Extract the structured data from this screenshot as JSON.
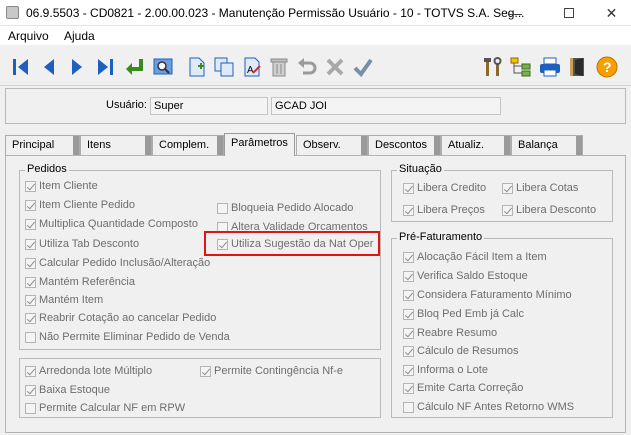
{
  "window": {
    "title": "06.9.5503 - CD0821 - 2.00.00.023 - Manutenção Permissão Usuário - 10 - TOTVS S.A. Seg...",
    "minimize": "—",
    "close": "✕"
  },
  "menu": [
    "Arquivo",
    "Ajuda"
  ],
  "toolbar": {
    "icons": [
      "first-icon",
      "prev-icon",
      "next-icon",
      "last-icon",
      "goto-icon",
      "search-icon",
      "new-icon",
      "copy-icon",
      "edit-icon",
      "delete-icon",
      "undo-icon",
      "cancel-icon",
      "confirm-icon",
      "tools-icon",
      "tree-icon",
      "print-icon",
      "exit-icon",
      "help-icon"
    ],
    "colors": {
      "blue": "#1f5fbf",
      "green": "#3a8a1e",
      "grey": "#9a9a9a",
      "orange": "#f5a000"
    }
  },
  "user": {
    "label": "Usuário:",
    "code": "Super",
    "name": "GCAD JOI"
  },
  "tabs": [
    "Principal",
    "Itens",
    "Complem.",
    "Parâmetros",
    "Observ.",
    "Descontos",
    "Atualiz.",
    "Balança"
  ],
  "active_tab": "Parâmetros",
  "pedidos": {
    "title": "Pedidos",
    "left": [
      {
        "label": "Item Cliente",
        "checked": true
      },
      {
        "label": "Item Cliente Pedido",
        "checked": true
      },
      {
        "label": "Multiplica Quantidade Composto",
        "checked": true
      },
      {
        "label": "Utiliza Tab Desconto",
        "checked": true
      },
      {
        "label": "Calcular Pedido Inclusão/Alteração",
        "checked": true
      },
      {
        "label": "Mantém Referência",
        "checked": true
      },
      {
        "label": "Mantém Item",
        "checked": true
      },
      {
        "label": "Reabrir Cotação ao cancelar Pedido",
        "checked": true
      },
      {
        "label": "Não Permite Eliminar Pedido de Venda",
        "checked": false
      }
    ],
    "right": [
      {
        "label": "Bloqueia Pedido Alocado",
        "checked": false
      },
      {
        "label": "Altera Validade Orcamentos",
        "checked": false
      },
      {
        "label": "Utiliza Sugestão da Nat Oper",
        "checked": true
      }
    ]
  },
  "lote": {
    "items": [
      {
        "label": "Arredonda lote Múltiplo",
        "checked": true
      },
      {
        "label": "Baixa Estoque",
        "checked": true
      },
      {
        "label": "Permite Calcular NF em RPW",
        "checked": false
      },
      {
        "label": "Permite Contingência Nf-e",
        "checked": true
      }
    ]
  },
  "situacao": {
    "title": "Situação",
    "items": [
      {
        "label": "Libera Credito",
        "checked": true
      },
      {
        "label": "Libera Cotas",
        "checked": true
      },
      {
        "label": "Libera Preços",
        "checked": true
      },
      {
        "label": "Libera Desconto",
        "checked": true
      }
    ]
  },
  "pre_faturamento": {
    "title": "Pré-Faturamento",
    "items": [
      {
        "label": "Alocação Fácil Item a Item",
        "checked": true
      },
      {
        "label": "Verifica Saldo Estoque",
        "checked": true
      },
      {
        "label": "Considera Faturamento Mínimo",
        "checked": true
      },
      {
        "label": "Bloq Ped Emb já Calc",
        "checked": true
      },
      {
        "label": "Reabre Resumo",
        "checked": true
      },
      {
        "label": "Cálculo de Resumos",
        "checked": true
      },
      {
        "label": "Informa o Lote",
        "checked": true
      },
      {
        "label": "Emite Carta Correção",
        "checked": true
      },
      {
        "label": "Cálculo NF Antes Retorno WMS",
        "checked": false
      }
    ]
  }
}
